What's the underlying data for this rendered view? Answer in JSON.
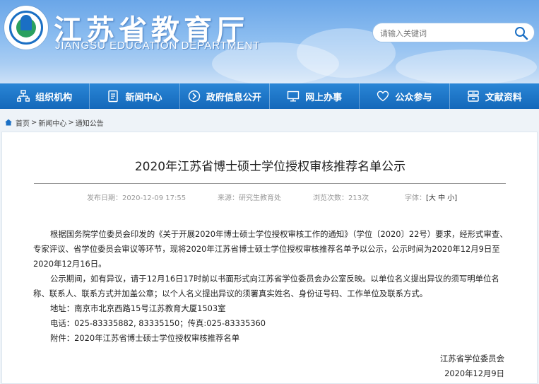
{
  "header": {
    "title": "江苏省教育厅",
    "subtitle": "JIANGSU EDUCATION DEPARTMENT",
    "search_placeholder": "请输入关键词"
  },
  "colors": {
    "header_blue": "#6aa6e8",
    "nav_blue": "#1468ba",
    "text": "#222222",
    "meta_gray": "#999999"
  },
  "nav": {
    "items": [
      {
        "label": "组织机构",
        "icon": "org-chart-icon"
      },
      {
        "label": "新闻中心",
        "icon": "news-icon"
      },
      {
        "label": "政府信息公开",
        "icon": "gov-info-icon"
      },
      {
        "label": "网上办事",
        "icon": "monitor-icon"
      },
      {
        "label": "公众参与",
        "icon": "heart-icon"
      },
      {
        "label": "文献资料",
        "icon": "archive-icon"
      }
    ]
  },
  "breadcrumb": {
    "home": "首页",
    "sep": ">",
    "level1": "新闻中心",
    "level2": "通知公告"
  },
  "article": {
    "title": "2020年江苏省博士硕士学位授权审核推荐名单公示",
    "publish_date": "发布日期：2020-12-09 17:55",
    "source": "来源：研究生教育处",
    "views": "浏览次数：213次",
    "font_label": "字体：",
    "font_open": "[",
    "font_large": "大",
    "font_medium": "中",
    "font_small": "小",
    "font_close": "]",
    "para1": "根据国务院学位委员会印发的《关于开展2020年博士硕士学位授权审核工作的通知》（学位〔2020〕22号）要求，经形式审查、专家评议、省学位委员会审议等环节，现将2020年江苏省博士硕士学位授权审核推荐名单予以公示，公示时间为2020年12月9日至2020年12月16日。",
    "para2": "公示期间，如有异议，请于12月16日17时前以书面形式向江苏省学位委员会办公室反映。以单位名义提出异议的须写明单位名称、联系人、联系方式并加盖公章；以个人名义提出异议的须署真实姓名、身份证号码、工作单位及联系方式。",
    "address": "地址：南京市北京西路15号江苏教育大厦1503室",
    "phone": "电话：025-83335882, 83335150；传真:025-83335360",
    "attachment": "附件：2020年江苏省博士硕士学位授权审核推荐名单",
    "signoff_org": "江苏省学位委员会",
    "signoff_date": "2020年12月9日"
  }
}
